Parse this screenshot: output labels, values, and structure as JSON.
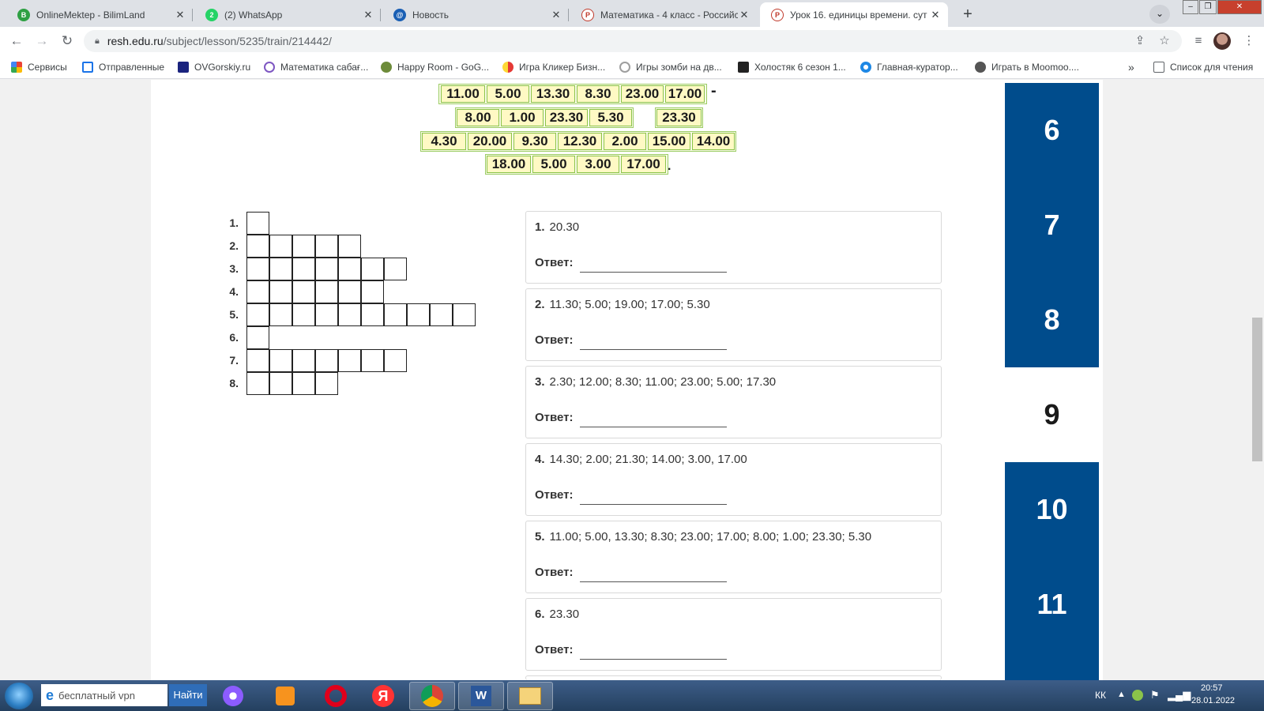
{
  "tabs": [
    {
      "title": "OnlineMektep - BilimLand",
      "icon": "bilimland-icon",
      "color": "#2ea043"
    },
    {
      "title": "(2) WhatsApp",
      "icon": "whatsapp-icon",
      "color": "#25d366",
      "badge": "2"
    },
    {
      "title": "Новость",
      "icon": "mail-at-icon",
      "color": "#1a5fb4"
    },
    {
      "title": "Математика - 4 класс - Российс",
      "icon": "resh-icon",
      "color": "#c0392b"
    },
    {
      "title": "Урок 16. единицы времени. сут",
      "icon": "resh-icon",
      "color": "#c0392b"
    }
  ],
  "toolbar": {
    "url_host": "resh.edu.ru",
    "url_path": "/subject/lesson/5235/train/214442/"
  },
  "bookmarks": [
    {
      "label": "Сервисы",
      "icon": "apps-grid-icon"
    },
    {
      "label": "Отправленные",
      "icon": "mail-icon"
    },
    {
      "label": "OVGorskiy.ru",
      "icon": "ovg-icon"
    },
    {
      "label": "Математика сабағ...",
      "icon": "ring-icon"
    },
    {
      "label": "Happy Room - GoG...",
      "icon": "happy-room-icon"
    },
    {
      "label": "Игра Кликер Бизн...",
      "icon": "circle-game-icon"
    },
    {
      "label": "Игры зомби на дв...",
      "icon": "google-g-icon"
    },
    {
      "label": "Холостяк 6 сезон 1...",
      "icon": "k-icon"
    },
    {
      "label": "Главная-куратор...",
      "icon": "globe-blue-icon"
    },
    {
      "label": "Играть в Moomoo....",
      "icon": "globe-icon"
    }
  ],
  "bookmarks_more": "»",
  "reading_list": "Список для чтения",
  "time_rows": [
    [
      "11.00",
      "5.00",
      "13.30",
      "8.30",
      "23.00",
      "17.00"
    ],
    [
      "8.00",
      "1.00",
      "23.30",
      "5.30"
    ],
    [
      "23.30"
    ],
    [
      "4.30",
      "20.00",
      "9.30",
      "12.30",
      "2.00",
      "15.00",
      "14.00"
    ],
    [
      "18.00",
      "5.00",
      "3.00",
      "17.00"
    ]
  ],
  "row1_suffix": "-",
  "row4_suffix": ".",
  "crossword": {
    "labels": [
      "1.",
      "2.",
      "3.",
      "4.",
      "5.",
      "6.",
      "7.",
      "8."
    ],
    "row_lengths": [
      1,
      5,
      7,
      6,
      10,
      1,
      7,
      4
    ]
  },
  "questions": [
    {
      "num": "1.",
      "text": "20.30"
    },
    {
      "num": "2.",
      "text": "11.30; 5.00; 19.00; 17.00; 5.30"
    },
    {
      "num": "3.",
      "text": "2.30; 12.00; 8.30; 11.00; 23.00; 5.00; 17.30"
    },
    {
      "num": "4.",
      "text": "14.30; 2.00; 21.30; 14.00; 3.00, 17.00"
    },
    {
      "num": "5.",
      "text": "11.00; 5.00, 13.30; 8.30; 23.00; 17.00; 8.00; 1.00; 23.30; 5.30"
    },
    {
      "num": "6.",
      "text": "23.30"
    }
  ],
  "answer_label": "Ответ:",
  "task_numbers": [
    "6",
    "7",
    "8",
    "9",
    "10",
    "11"
  ],
  "active_task": "9",
  "taskbar": {
    "search_text": "бесплатный vpn",
    "find_label": "Найти",
    "lang": "КК",
    "time": "20:57",
    "date": "28.01.2022"
  },
  "colors": {
    "accent_blue": "#004c8c",
    "time_cell_bg": "#fff9c4",
    "time_cell_border": "#8bc34a"
  }
}
